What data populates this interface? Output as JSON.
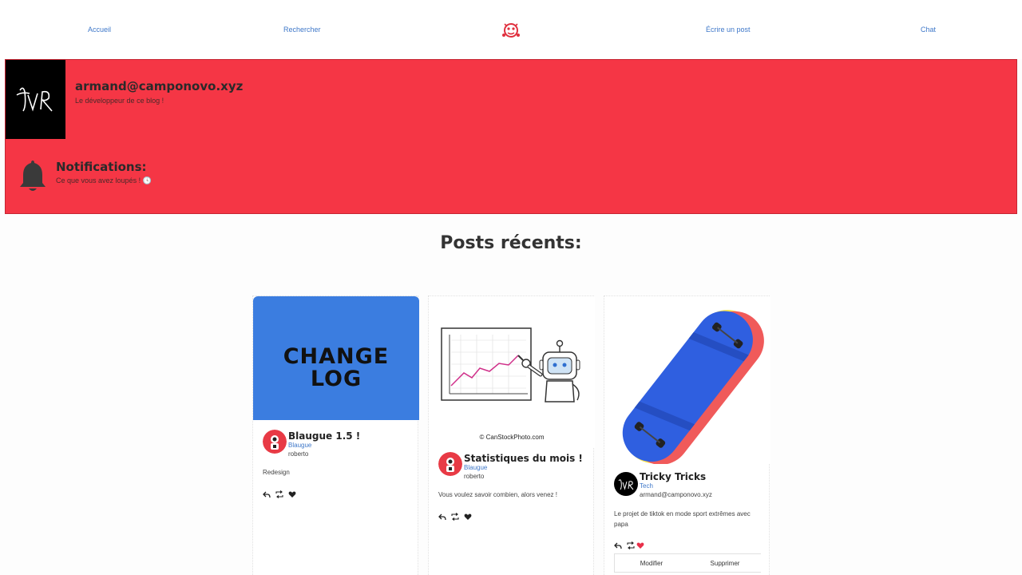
{
  "nav": {
    "home": "Accueil",
    "search": "Rechercher",
    "write": "Écrire un post",
    "chat": "Chat",
    "logo_icon": "blog-logo-icon"
  },
  "profile": {
    "username": "armand@camponovo.xyz",
    "description": "Le développeur de ce blog !",
    "avatar_icon": "signature-avatar-icon"
  },
  "notifications": {
    "title": "Notifications:",
    "subtitle": "Ce que vous avez loupés ! 🕓",
    "icon": "bell-icon"
  },
  "posts_section": {
    "title": "Posts récents:"
  },
  "posts": [
    {
      "image_text_line1": "CHANGE",
      "image_text_line2": "LOG",
      "title": "Blaugue 1.5 !",
      "category": "Blaugue",
      "author": "roberto",
      "body": "Redesign",
      "liked": false
    },
    {
      "image_caption": "© CanStockPhoto.com",
      "title": "Statistiques du mois !",
      "category": "Blaugue",
      "author": "roberto",
      "body": "Vous voulez savoir combien, alors venez !",
      "liked": false
    },
    {
      "title": "Tricky Tricks",
      "category": "Tech",
      "author": "armand@camponovo.xyz",
      "body": "Le projet de tiktok en mode sport extrêmes avec papa",
      "liked": true,
      "edit_label": "Modifier",
      "delete_label": "Supprimer"
    }
  ],
  "colors": {
    "accent_red": "#f53645",
    "link_blue": "#3f78c9",
    "changelog_blue": "#3b7de0"
  }
}
